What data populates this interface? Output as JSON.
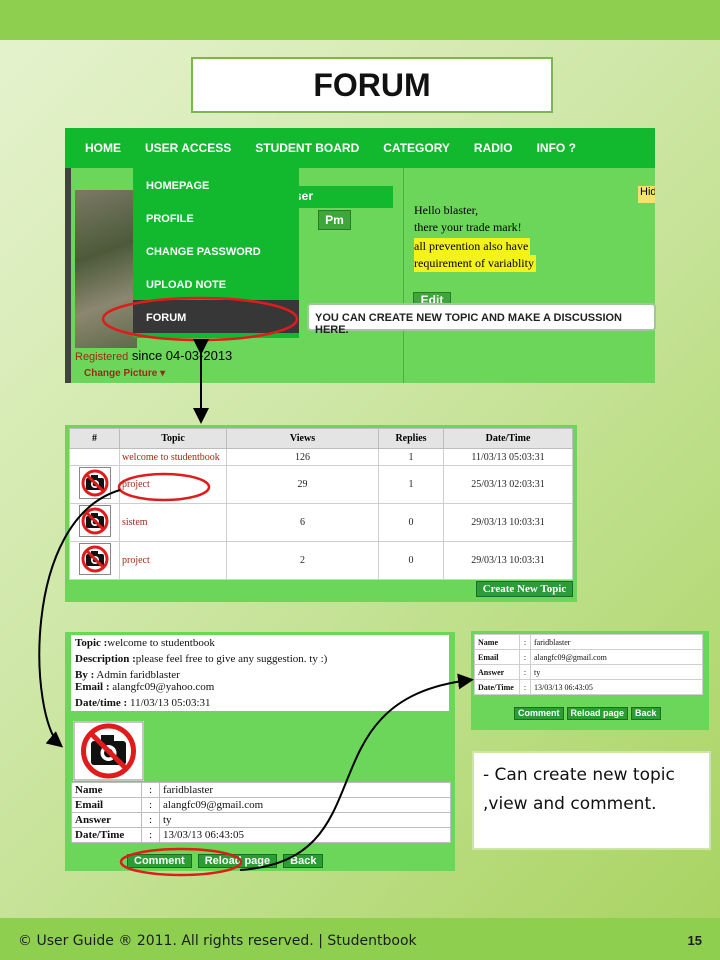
{
  "slide": {
    "title": "FORUM",
    "footer": "© User Guide ® 2011. All rights reserved. | Studentbook",
    "page_number": "15"
  },
  "nav": {
    "items": [
      "HOME",
      "USER ACCESS",
      "STUDENT BOARD",
      "CATEGORY",
      "RADIO",
      "INFO ?"
    ]
  },
  "dropdown": {
    "items": [
      "HOMEPAGE",
      "PROFILE",
      "CHANGE PASSWORD",
      "UPLOAD NOTE",
      "FORUM"
    ]
  },
  "profile": {
    "user_label": "ser",
    "pm": "Pm",
    "registered_label": "Registered",
    "registered_since": "since 04-03-2013",
    "change_picture": "Change Picture",
    "hello_1": "Hello blaster,",
    "hello_2": "there your trade mark!",
    "hl_1": "all prevention also have",
    "hl_2": "requirement of variablity",
    "edit": "Edit",
    "hide": "Hid"
  },
  "tooltip": "YOU CAN CREATE NEW TOPIC AND MAKE A DISCUSSION HERE.",
  "topics": {
    "headers": [
      "#",
      "Topic",
      "Views",
      "Replies",
      "Date/Time"
    ],
    "rows": [
      {
        "topic": "welcome to studentbook",
        "views": "126",
        "replies": "1",
        "date": "11/03/13 05:03:31",
        "img": false
      },
      {
        "topic": "project",
        "views": "29",
        "replies": "1",
        "date": "25/03/13 02:03:31",
        "img": true
      },
      {
        "topic": "sistem",
        "views": "6",
        "replies": "0",
        "date": "29/03/13 10:03:31",
        "img": true
      },
      {
        "topic": "project",
        "views": "2",
        "replies": "0",
        "date": "29/03/13 10:03:31",
        "img": true
      }
    ],
    "create_button": "Create New Topic"
  },
  "detail": {
    "topic_label": "Topic :",
    "topic": "welcome to studentbook",
    "desc_label": "Description :",
    "desc": "please feel free to give any suggestion. ty :)",
    "by_label": "By :",
    "by": "Admin faridblaster",
    "email_label": "Email :",
    "email": "alangfc09@yahoo.com",
    "date_label": "Date/time :",
    "date": "11/03/13 05:03:31",
    "reply": [
      {
        "k": "Name",
        "v": "faridblaster"
      },
      {
        "k": "Email",
        "v": "alangfc09@gmail.com"
      },
      {
        "k": "Answer",
        "v": "ty"
      },
      {
        "k": "Date/Time",
        "v": "13/03/13 06:43:05"
      }
    ],
    "buttons": [
      "Comment",
      "Reload page",
      "Back"
    ]
  },
  "detail_small": {
    "reply": [
      {
        "k": "Name",
        "v": "faridblaster"
      },
      {
        "k": "Email",
        "v": "alangfc09@gmail.com"
      },
      {
        "k": "Answer",
        "v": "ty"
      },
      {
        "k": "Date/Time",
        "v": "13/03/13 06:43:05"
      }
    ],
    "buttons": [
      "Comment",
      "Reload page",
      "Back"
    ]
  },
  "note": {
    "line1": "- Can create new topic",
    "line2": ",view and comment."
  }
}
